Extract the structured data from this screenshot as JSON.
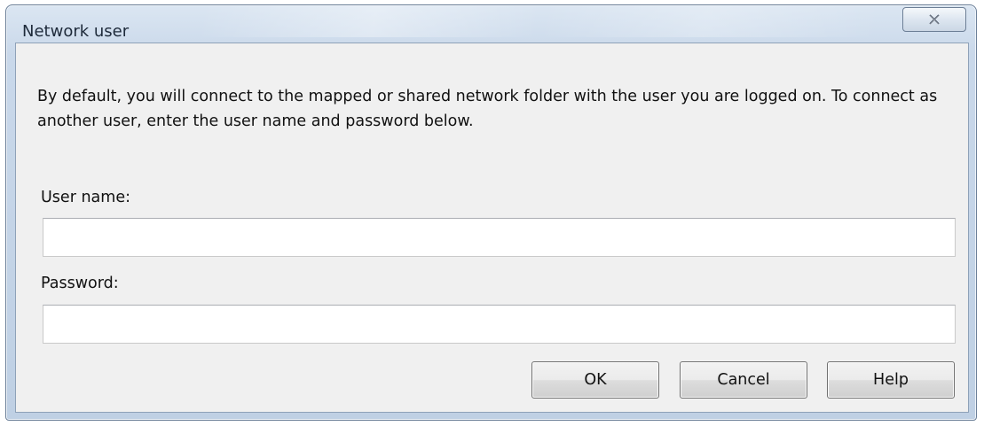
{
  "window": {
    "title": "Network user",
    "close_icon": "close-icon"
  },
  "message": "By default, you will connect to the mapped or shared network folder with the user you are logged on. To connect as another user, enter the user name and password below.",
  "fields": {
    "username": {
      "label": "User name:",
      "value": "",
      "placeholder": ""
    },
    "password": {
      "label": "Password:",
      "value": "",
      "placeholder": ""
    }
  },
  "buttons": {
    "ok": "OK",
    "cancel": "Cancel",
    "help": "Help"
  }
}
